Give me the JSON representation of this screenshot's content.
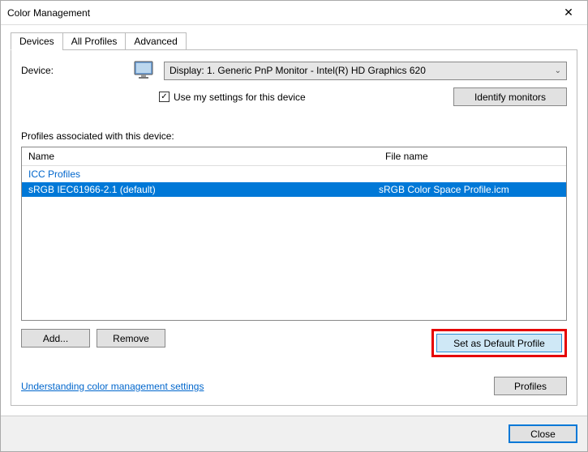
{
  "titlebar": {
    "title": "Color Management"
  },
  "tabs": {
    "devices": "Devices",
    "all_profiles": "All Profiles",
    "advanced": "Advanced"
  },
  "device": {
    "label": "Device:",
    "selected": "Display: 1. Generic PnP Monitor - Intel(R) HD Graphics 620",
    "use_my_settings": "Use my settings for this device",
    "identify": "Identify monitors"
  },
  "profiles": {
    "assoc_label": "Profiles associated with this device:",
    "cols": {
      "name": "Name",
      "file": "File name"
    },
    "group": "ICC Profiles",
    "items": [
      {
        "name": "sRGB IEC61966-2.1 (default)",
        "file": "sRGB Color Space Profile.icm"
      }
    ]
  },
  "buttons": {
    "add": "Add...",
    "remove": "Remove",
    "set_default": "Set as Default Profile",
    "profiles": "Profiles",
    "close": "Close"
  },
  "link": {
    "understanding": "Understanding color management settings"
  }
}
